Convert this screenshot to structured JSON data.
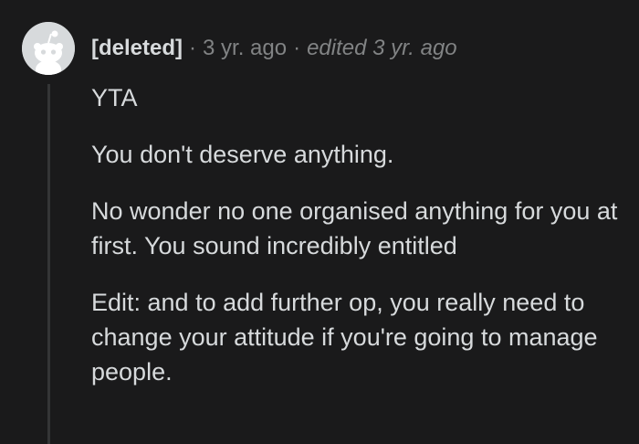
{
  "comment": {
    "author": "[deleted]",
    "separator": "·",
    "timestamp": "3 yr. ago",
    "edited": "edited 3 yr. ago",
    "avatar_icon": "snoo-avatar-icon",
    "paragraphs": [
      "YTA",
      "You don't deserve anything.",
      "No wonder no one organised anything for you at first. You sound incredibly entitled",
      "Edit: and to add further op, you really need to change your attitude if you're going to manage people."
    ]
  },
  "colors": {
    "background": "#1a1a1b",
    "text": "#d7dadc",
    "meta": "#818384",
    "thread_line": "#343536"
  }
}
